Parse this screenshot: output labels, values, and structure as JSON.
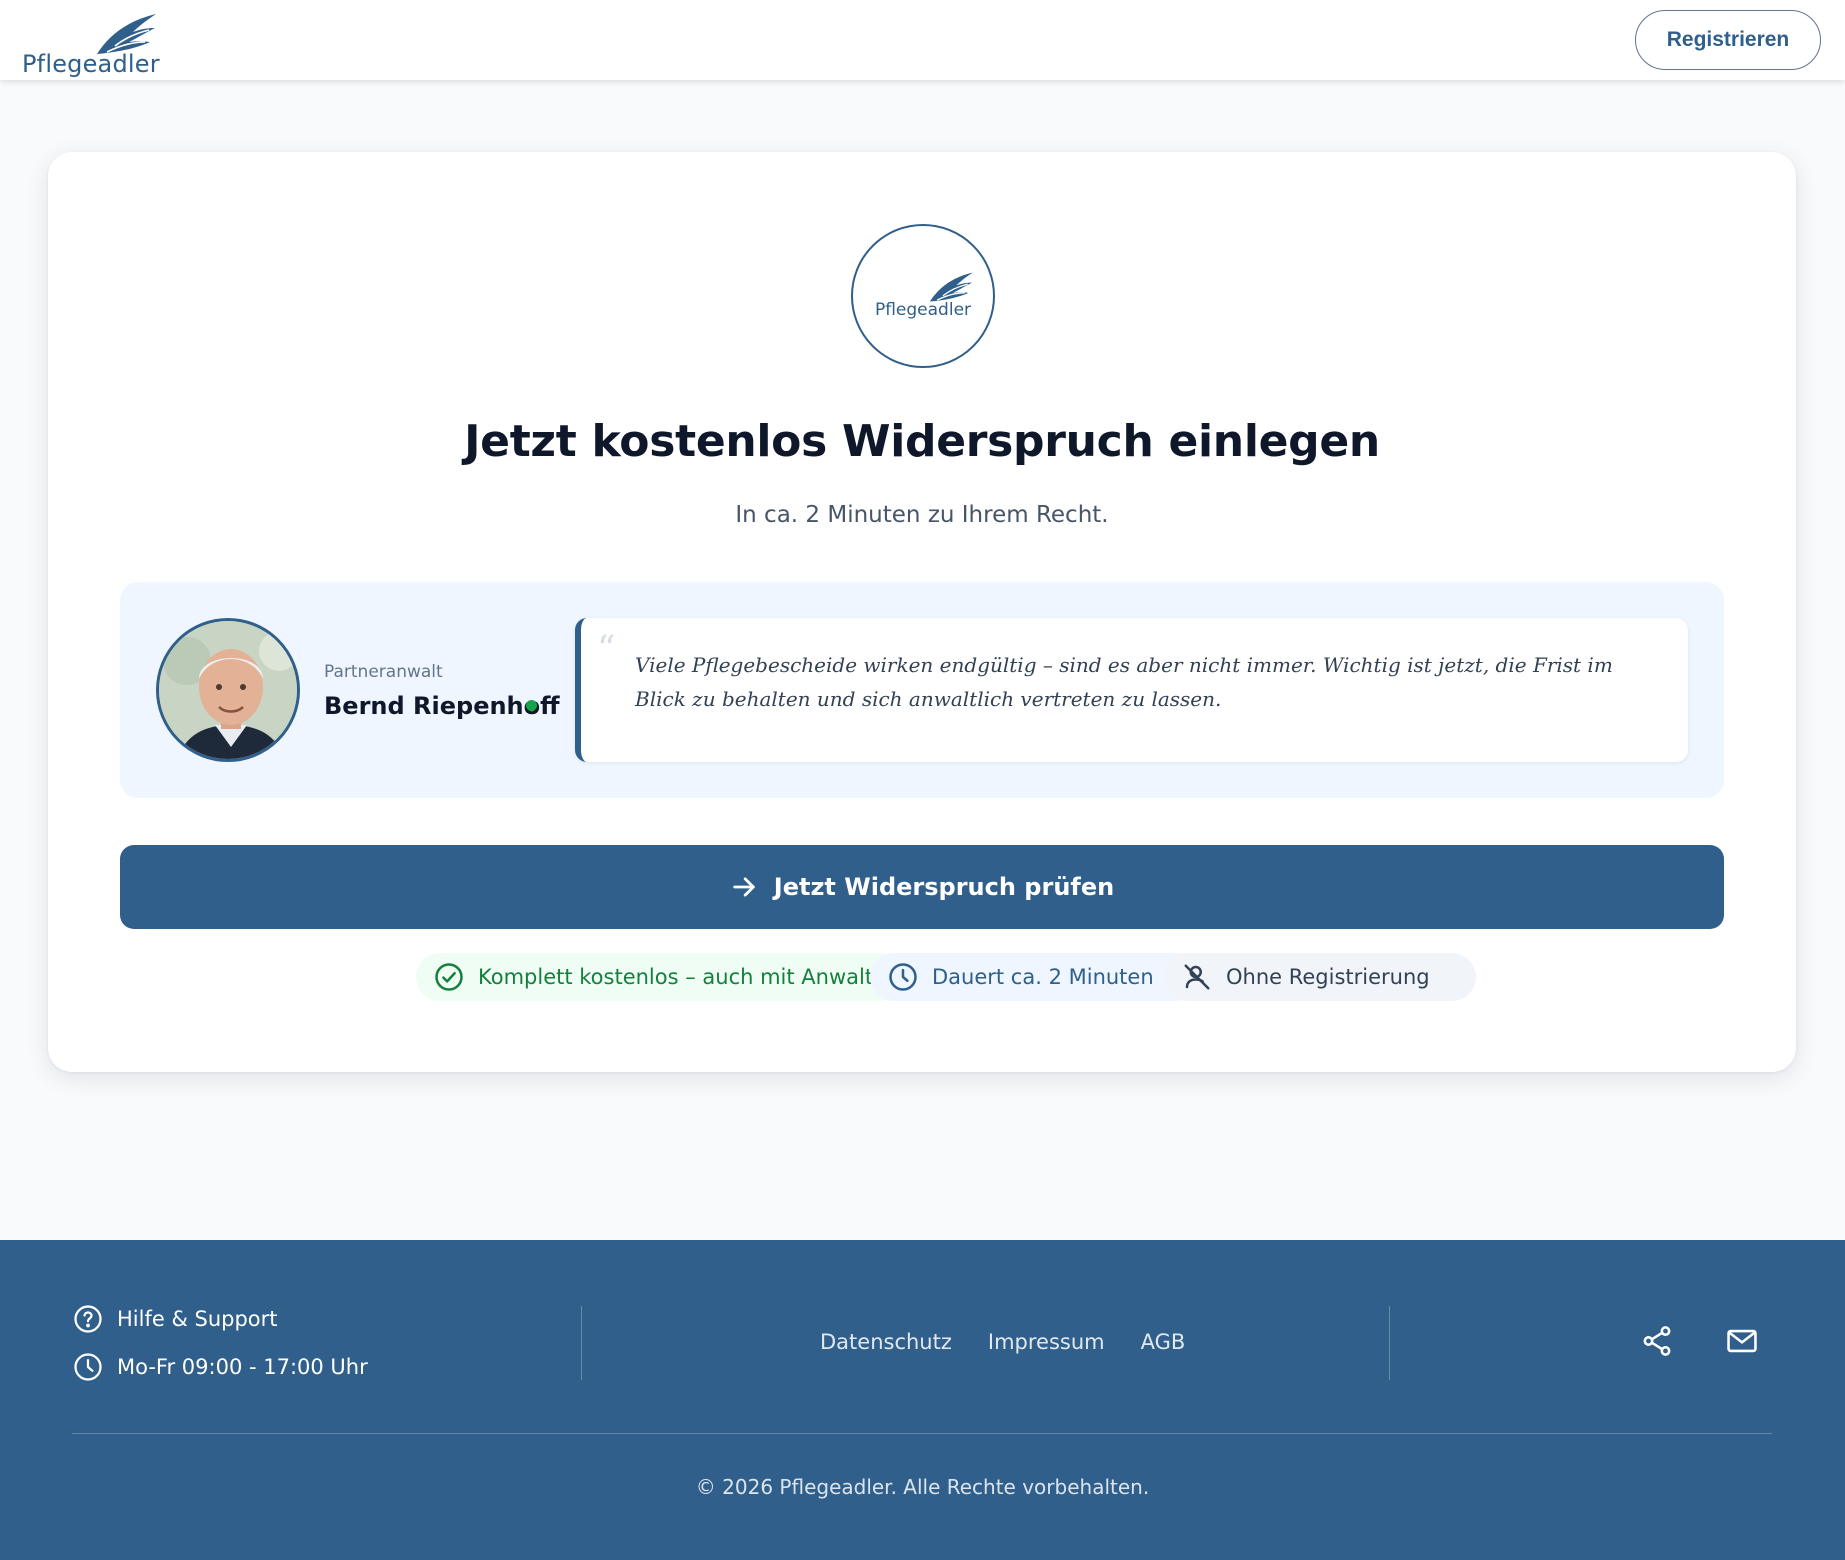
{
  "brand": {
    "name": "Pflegeadler",
    "primary_color": "#2f5f8a",
    "logo_icon": "wing-icon"
  },
  "header": {
    "register_label": "Registrieren"
  },
  "hero": {
    "title": "Jetzt kostenlos Widerspruch einlegen",
    "subtitle": "In ca. 2 Minuten zu Ihrem Recht."
  },
  "lawyer": {
    "role": "Partneranwalt",
    "name": "Bernd Riepenhoff",
    "status": "online",
    "quote": "Viele Pflegebescheide wirken endgültig – sind es aber nicht immer. Wichtig ist jetzt, die Frist im Blick zu behalten und sich anwaltlich vertreten zu lassen."
  },
  "cta": {
    "label": "Jetzt Widerspruch prüfen",
    "icon": "arrow-right-icon"
  },
  "badges": [
    {
      "label": "Komplett kostenlos – auch mit Anwalt",
      "icon": "check-circle-icon",
      "color": "#15803d"
    },
    {
      "label": "Dauert ca. 2 Minuten",
      "icon": "clock-icon",
      "color": "#2f5f8a"
    },
    {
      "label": "Ohne Registrierung",
      "icon": "user-off-icon",
      "color": "#334155"
    }
  ],
  "footer": {
    "help_label": "Hilfe & Support",
    "hours_label": "Mo-Fr 09:00 - 17:00 Uhr",
    "links": [
      "Datenschutz",
      "Impressum",
      "AGB"
    ],
    "social_icons": [
      "share-icon",
      "mail-icon"
    ],
    "copyright": "© 2026 Pflegeadler. Alle Rechte vorbehalten."
  }
}
